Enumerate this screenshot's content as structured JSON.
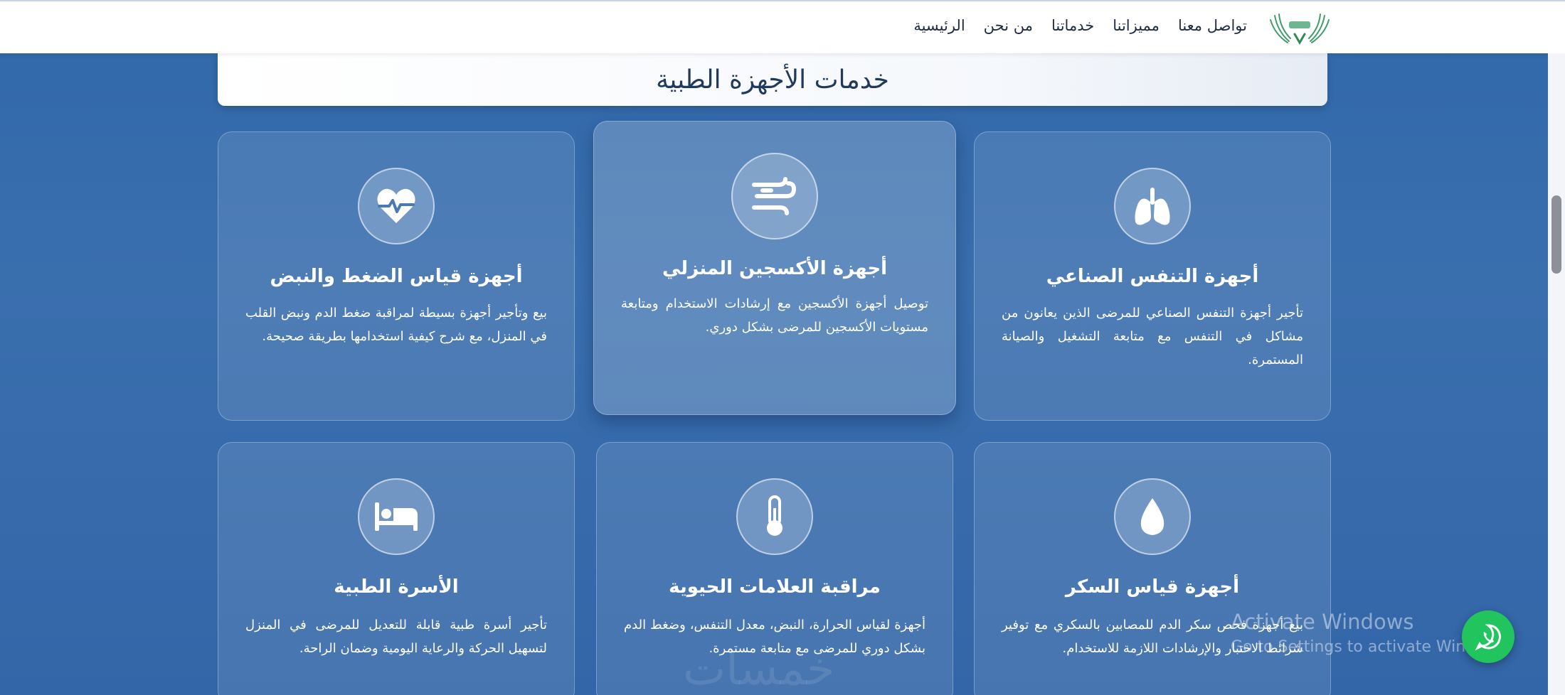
{
  "nav": {
    "items": [
      {
        "label": "الرئيسية"
      },
      {
        "label": "من نحن"
      },
      {
        "label": "خدماتنا"
      },
      {
        "label": "مميزاتنا"
      },
      {
        "label": "تواصل معنا"
      }
    ]
  },
  "section": {
    "title": "خدمات الأجهزة الطبية"
  },
  "cards": [
    {
      "icon": "lungs-icon",
      "title": "أجهزة التنفس الصناعي",
      "description": "تأجير أجهزة التنفس الصناعي للمرضى الذين يعانون من مشاكل في التنفس مع متابعة التشغيل والصيانة المستمرة."
    },
    {
      "icon": "wind-icon",
      "title": "أجهزة الأكسجين المنزلي",
      "description": "توصيل أجهزة الأكسجين مع إرشادات الاستخدام ومتابعة مستويات الأكسجين للمرضى بشكل دوري."
    },
    {
      "icon": "heart-pulse-icon",
      "title": "أجهزة قياس الضغط والنبض",
      "description": "بيع وتأجير أجهزة بسيطة لمراقبة ضغط الدم ونبض القلب في المنزل، مع شرح كيفية استخدامها بطريقة صحيحة."
    },
    {
      "icon": "droplet-icon",
      "title": "أجهزة قياس السكر",
      "description": "بيع أجهزة فحص سكر الدم للمصابين بالسكري مع توفير شرائط الاختبار والإرشادات اللازمة للاستخدام."
    },
    {
      "icon": "thermometer-icon",
      "title": "مراقبة العلامات الحيوية",
      "description": "أجهزة لقياس الحرارة، النبض، معدل التنفس، وضغط الدم بشكل دوري للمرضى مع متابعة مستمرة."
    },
    {
      "icon": "bed-icon",
      "title": "الأسرة الطبية",
      "description": "تأجير أسرة طبية قابلة للتعديل للمرضى في المنزل لتسهيل الحركة والرعاية اليومية وضمان الراحة."
    }
  ],
  "watermark": {
    "line1": "Activate Windows",
    "line2": "Go to Settings to activate Windows."
  },
  "footer_watermark": "خمسات",
  "colors": {
    "background": "#3068aa",
    "accent_green": "#22c45e",
    "title_text": "#1f3a5a"
  }
}
